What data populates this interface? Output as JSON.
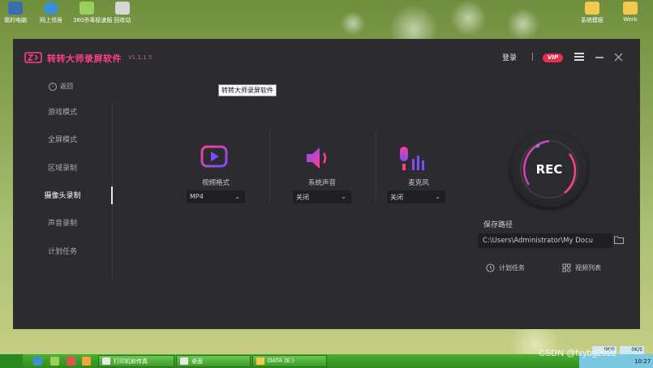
{
  "desktop": {
    "icons_left": [
      {
        "label": "我的电脑",
        "icon": "computer-icon",
        "color": "#3a6db0"
      },
      {
        "label": "网上邻居",
        "icon": "network-icon",
        "color": "#3b8fd6"
      },
      {
        "label": "360杀毒极速版",
        "icon": "antivirus-icon",
        "color": "#9ad05a"
      },
      {
        "label": "回收站",
        "icon": "recycle-bin-icon",
        "color": "#d6d6d6"
      }
    ],
    "icons_right": [
      {
        "label": "系统模板",
        "icon": "folder-icon",
        "color": "#f2c94c"
      },
      {
        "label": "Work",
        "icon": "folder-icon",
        "color": "#f2c94c"
      }
    ]
  },
  "window": {
    "app_name": "转转大师录屏软件",
    "version": "V1.1.1.5",
    "login": "登录",
    "vip": "VIP",
    "tooltip": "转转大师录屏软件",
    "back": "返回",
    "sidebar": [
      {
        "label": "游戏模式",
        "active": false
      },
      {
        "label": "全屏模式",
        "active": false
      },
      {
        "label": "区域录制",
        "active": false
      },
      {
        "label": "摄像头录制",
        "active": true
      },
      {
        "label": "声音录制",
        "active": false
      },
      {
        "label": "计划任务",
        "active": false
      }
    ],
    "options": [
      {
        "label": "视频格式",
        "value": "MP4",
        "icon": "video-format-icon"
      },
      {
        "label": "系统声音",
        "value": "关闭",
        "icon": "speaker-icon"
      },
      {
        "label": "麦克风",
        "value": "关闭",
        "icon": "microphone-icon"
      }
    ],
    "rec": "REC",
    "save_path_label": "保存路径",
    "save_path": "C:\\Users\\Administrator\\My Docu",
    "schedule": "计划任务",
    "video_list": "视频列表",
    "colors": {
      "accent": "#ff3f8d",
      "vip": "#e8304f",
      "background": "#2b2b30"
    }
  },
  "taskbar": {
    "buttons": [
      "打印机和传真",
      "桌面",
      "DATA (E:)"
    ],
    "clock": "10:27",
    "net_down": "0K/S",
    "net_up": "0K/S"
  },
  "watermark": "CSDN @fxybg2022"
}
